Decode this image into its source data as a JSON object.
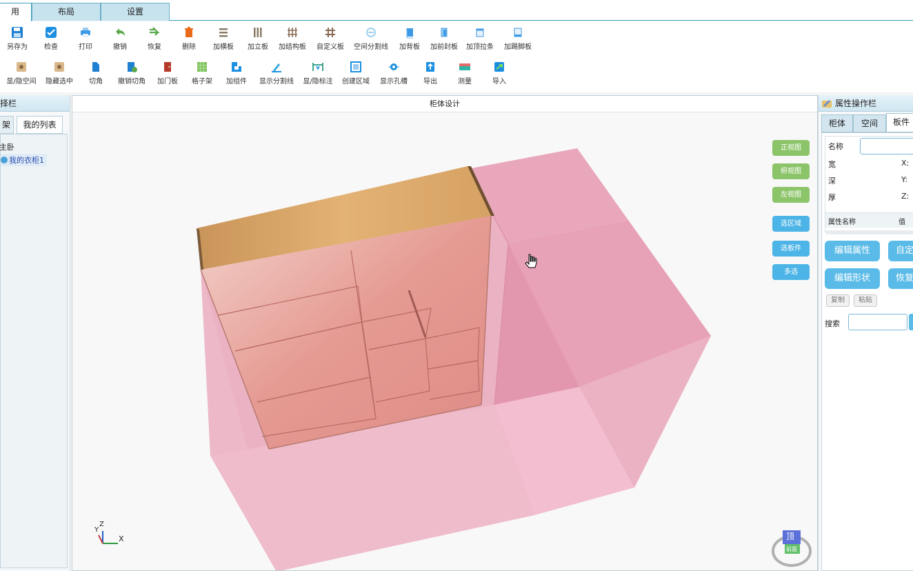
{
  "tabs": [
    {
      "label": "用"
    },
    {
      "label": "布局"
    },
    {
      "label": "设置"
    }
  ],
  "toolbar_row1": [
    {
      "label": "另存为",
      "icon": "save-as-icon"
    },
    {
      "label": "检查",
      "icon": "check-icon"
    },
    {
      "label": "打印",
      "icon": "print-icon"
    },
    {
      "label": "撤销",
      "icon": "undo-icon"
    },
    {
      "label": "恢复",
      "icon": "redo-icon"
    },
    {
      "label": "删除",
      "icon": "delete-icon"
    },
    {
      "label": "加横板",
      "icon": "horizontal-board-icon"
    },
    {
      "label": "加立板",
      "icon": "vertical-board-icon"
    },
    {
      "label": "加结构板",
      "icon": "structure-board-icon"
    },
    {
      "label": "自定义板",
      "icon": "custom-board-icon"
    },
    {
      "label": "空间分割线",
      "icon": "space-divider-icon"
    },
    {
      "label": "加背板",
      "icon": "back-board-icon"
    },
    {
      "label": "加前封板",
      "icon": "front-panel-icon"
    },
    {
      "label": "加顶拉条",
      "icon": "top-strip-icon"
    },
    {
      "label": "加踢脚板",
      "icon": "kick-board-icon"
    }
  ],
  "toolbar_row2": [
    {
      "label": "显/隐空间",
      "icon": "toggle-space-icon"
    },
    {
      "label": "隐藏选中",
      "icon": "hide-selected-icon"
    },
    {
      "label": "切角",
      "icon": "chamfer-icon"
    },
    {
      "label": "撤销切角",
      "icon": "undo-chamfer-icon"
    },
    {
      "label": "加门板",
      "icon": "door-icon"
    },
    {
      "label": "格子架",
      "icon": "grid-rack-icon"
    },
    {
      "label": "加组件",
      "icon": "add-component-icon"
    },
    {
      "label": "显示分割线",
      "icon": "show-divider-icon"
    },
    {
      "label": "显/隐标注",
      "icon": "toggle-dimension-icon"
    },
    {
      "label": "创建区域",
      "icon": "create-region-icon"
    },
    {
      "label": "显示孔槽",
      "icon": "show-holes-icon"
    },
    {
      "label": "导出",
      "icon": "export-icon"
    },
    {
      "label": "测量",
      "icon": "measure-icon"
    },
    {
      "label": "导入",
      "icon": "import-icon"
    }
  ],
  "left_panel": {
    "title": "择栏",
    "tabs": [
      "架",
      "我的列表"
    ],
    "tree_root": "主卧",
    "tree_item": "我的衣柜1"
  },
  "viewport": {
    "title": "柜体设计",
    "view_buttons": [
      "正视图",
      "俯视图",
      "左视图"
    ],
    "select_buttons": [
      "选区域",
      "选板件",
      "多选"
    ],
    "axis": {
      "x": "X",
      "y": "Y",
      "z": "Z"
    },
    "cube_top": "顶",
    "cube_front": "前面"
  },
  "right_panel": {
    "title": "属性操作栏",
    "tabs": [
      "柜体",
      "空间",
      "板件"
    ],
    "name_label": "名称",
    "width_label": "宽",
    "depth_label": "深",
    "thick_label": "厚",
    "x_label": "X:",
    "y_label": "Y:",
    "z_label": "Z:",
    "prop_name_header": "属性名称",
    "prop_value_header": "值",
    "btn_edit_props": "编辑属性",
    "btn_custom": "自定",
    "btn_edit_shape": "编辑形状",
    "btn_restore": "恢复",
    "btn_copy": "复制",
    "btn_paste": "粘贴",
    "search_label": "搜索"
  },
  "colors": {
    "accent": "#3c9fc0",
    "button_blue": "#5bbbe8",
    "view_green": "#8cc46a",
    "wood": "#d9a766",
    "pink_space": "#e9a3b9"
  }
}
